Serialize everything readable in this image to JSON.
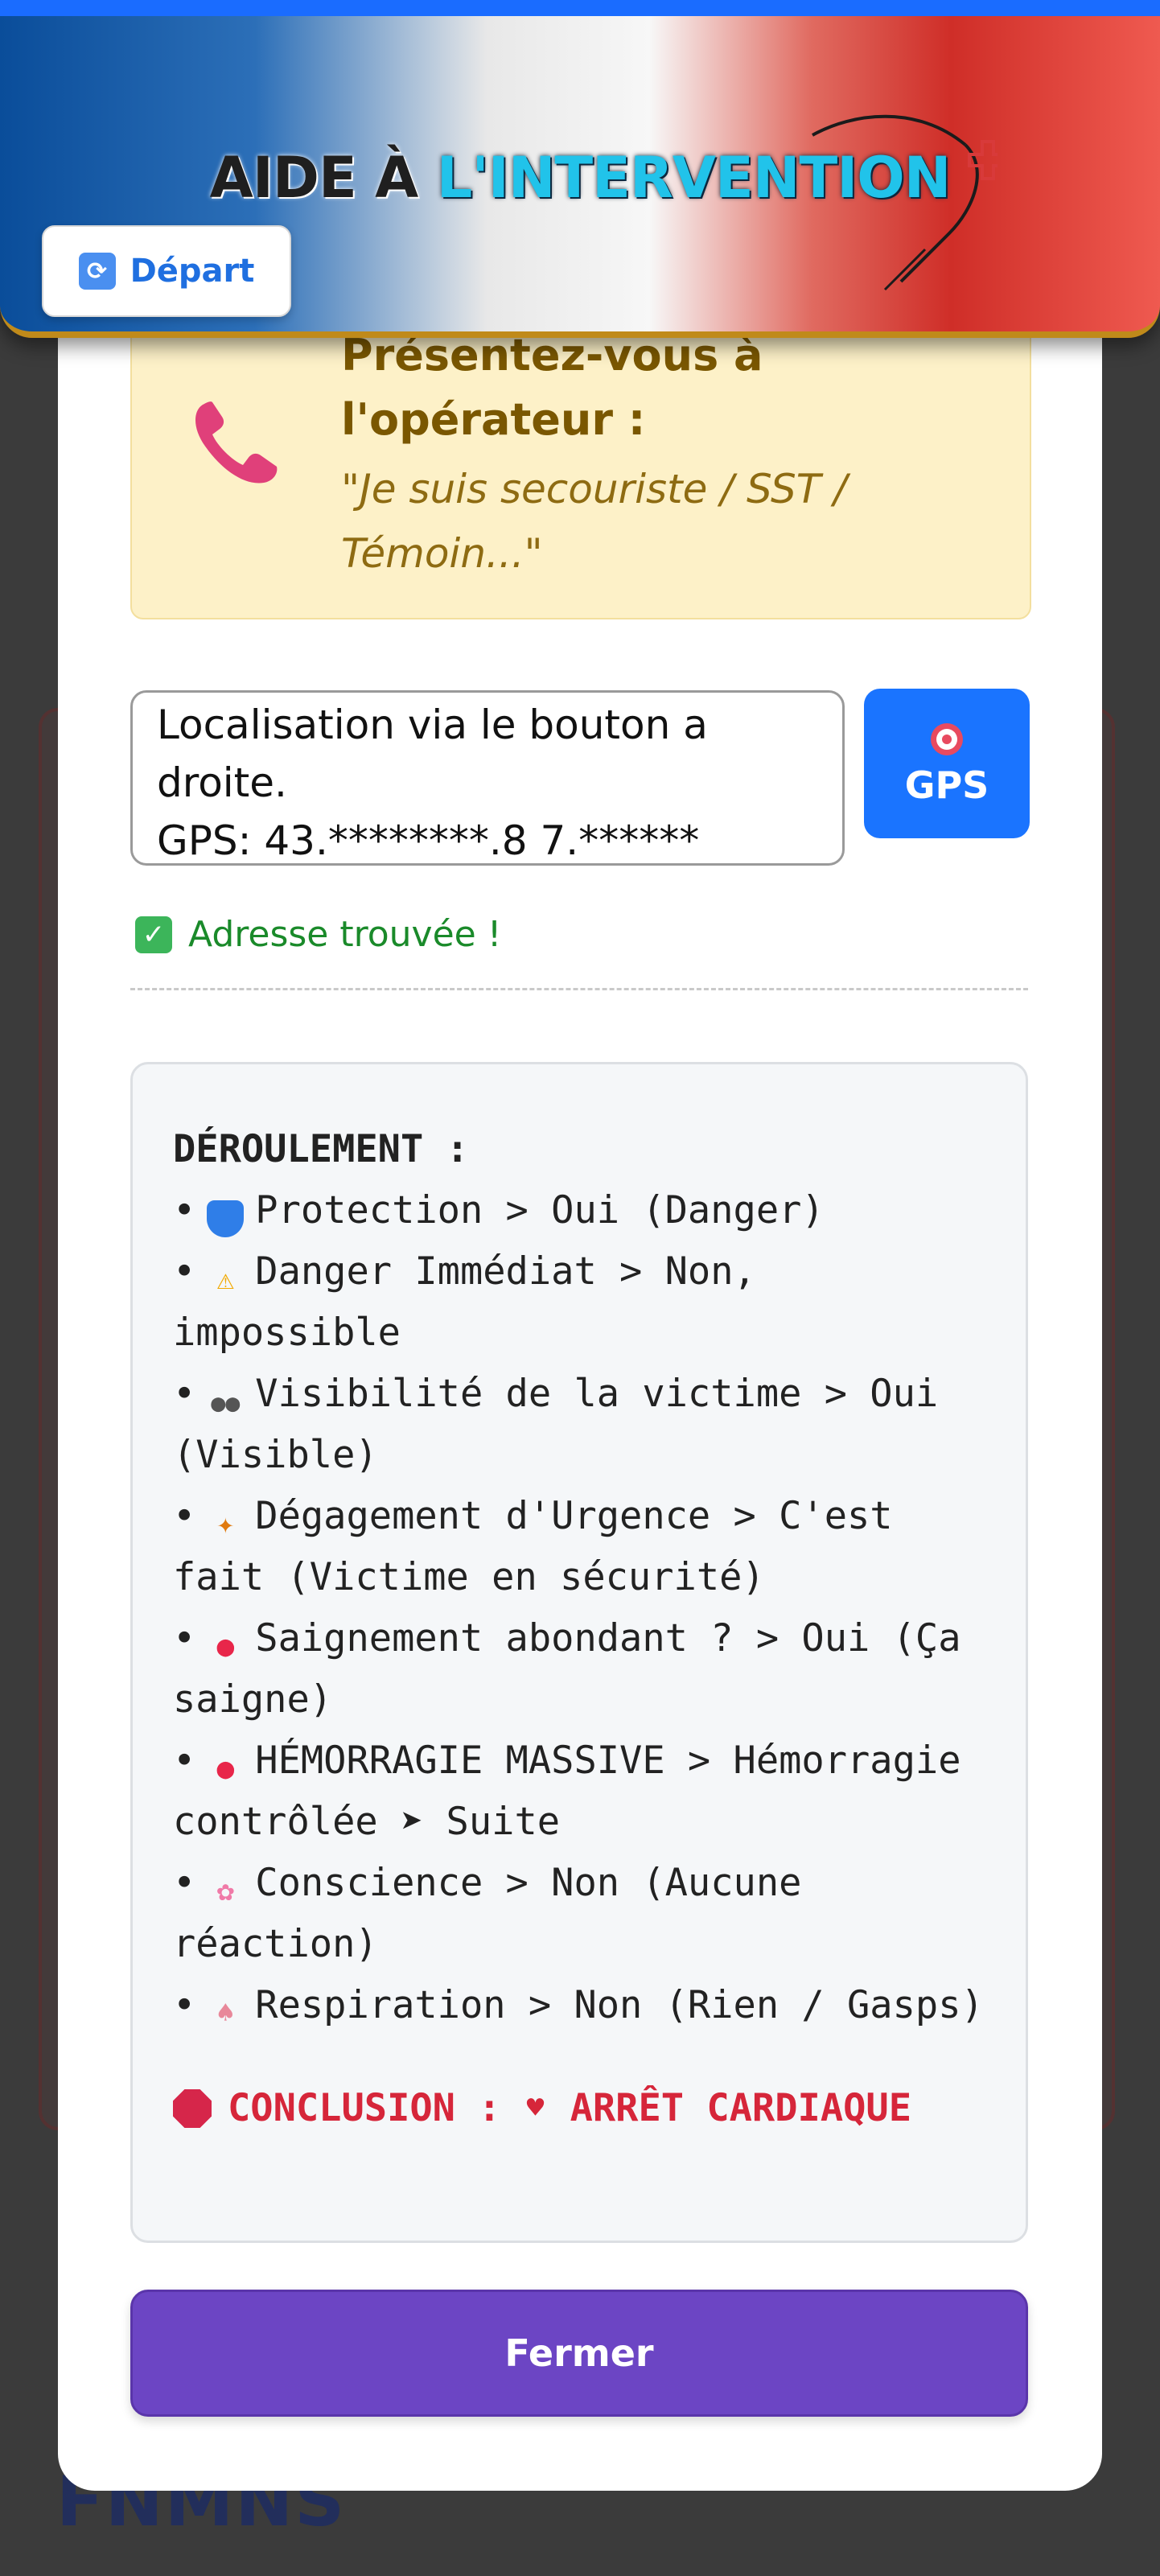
{
  "header": {
    "title_part1": "AIDE À",
    "title_part2": "L'INTERVENTION",
    "depart_label": "Départ",
    "depart_icon": "refresh-icon"
  },
  "callout": {
    "icon": "phone-icon",
    "title": "Présentez-vous à l'opérateur :",
    "quote": "\"Je suis secouriste / SST / Témoin...\""
  },
  "address": {
    "value": "Localisation via le bouton a droite.\nGPS: 43.********.8 7.******"
  },
  "gps_button": {
    "label": "GPS",
    "icon": "target-icon"
  },
  "status": {
    "text": "Adresse trouvée !",
    "icon": "check-icon"
  },
  "summary": {
    "heading": "DÉROULEMENT :",
    "steps": [
      {
        "icon": "shield-icon",
        "text": "Protection > Oui (Danger)"
      },
      {
        "icon": "warning-icon",
        "text": "Danger Immédiat > Non, impossible"
      },
      {
        "icon": "eyes-icon",
        "text": "Visibilité de la victime > Oui (Visible)"
      },
      {
        "icon": "running-icon",
        "text": "Dégagement d'Urgence > C'est fait (Victime en sécurité)"
      },
      {
        "icon": "drop-icon",
        "text": "Saignement abondant ? > Oui (Ça saigne)"
      },
      {
        "icon": "drop-icon",
        "text": "HÉMORRAGIE MASSIVE > Hémorragie contrôlée ➤ Suite"
      },
      {
        "icon": "brain-icon",
        "text": "Conscience > Non (Aucune réaction)"
      },
      {
        "icon": "lungs-icon",
        "text": "Respiration > Non (Rien / Gasps)"
      }
    ],
    "bullet": "•",
    "conclusion_label": "CONCLUSION :",
    "conclusion_value": "ARRÊT CARDIAQUE"
  },
  "close_button": {
    "label": "Fermer"
  },
  "colors": {
    "accent_blue": "#1a74ff",
    "purple": "#6c45c4",
    "conclusion_red": "#d6263a",
    "callout_bg": "#fdf1c8"
  },
  "backdrop_logo": "FNMNS"
}
